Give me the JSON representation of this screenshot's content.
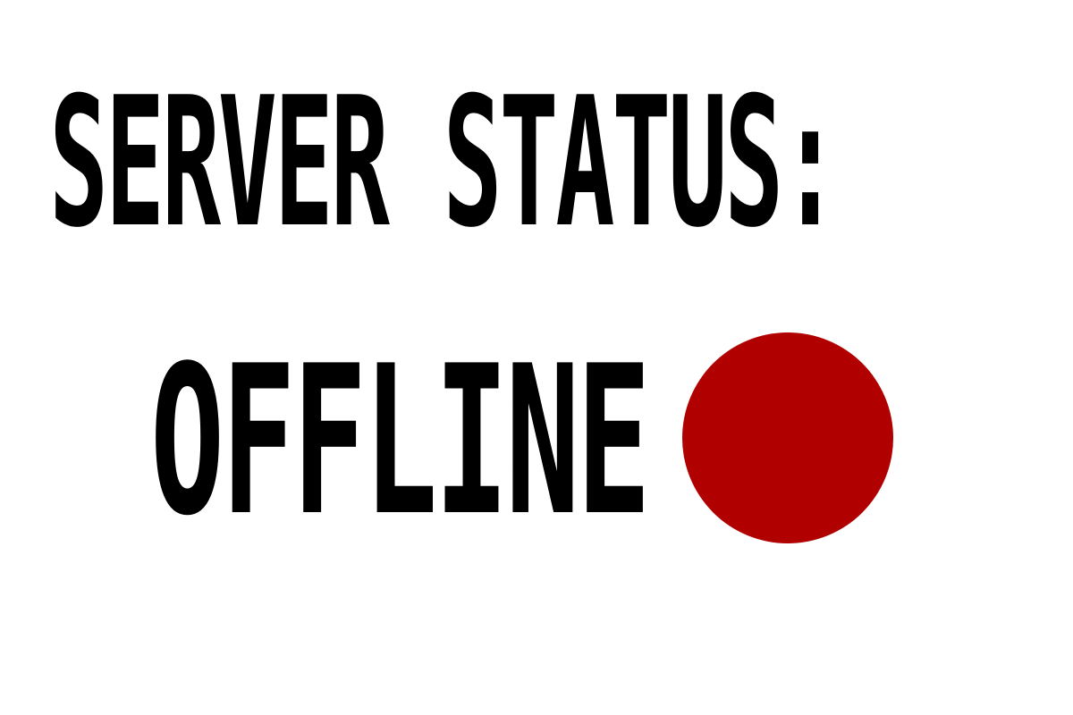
{
  "heading": "SERVER STATUS:",
  "status": {
    "label": "OFFLINE",
    "indicator_icon": "status-dot-icon",
    "indicator_color": "#b00000"
  }
}
